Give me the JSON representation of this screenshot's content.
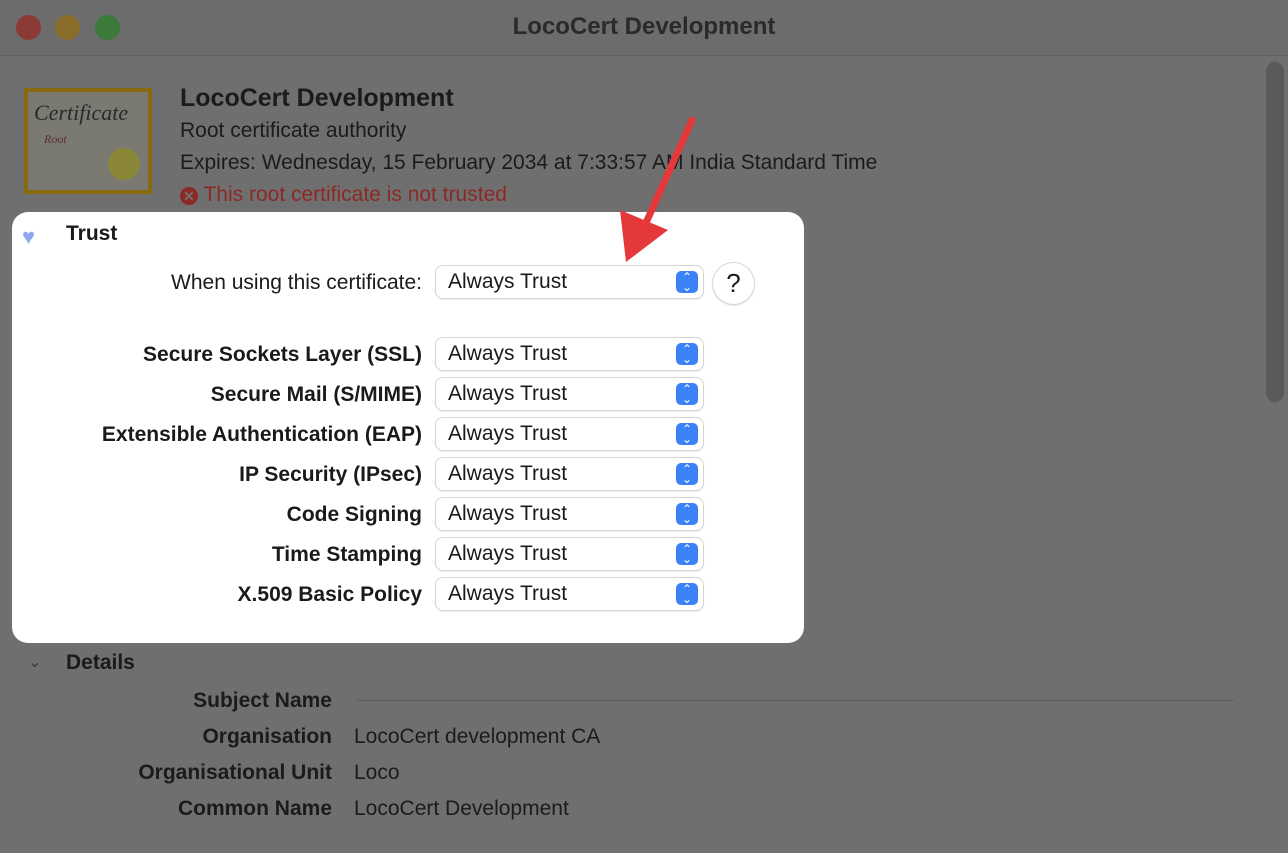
{
  "window": {
    "title": "LocoCert Development"
  },
  "header": {
    "name": "LocoCert Development",
    "kind": "Root certificate authority",
    "expires": "Expires: Wednesday, 15 February 2034 at 7:33:57 AM India Standard Time",
    "status": "This root certificate is not trusted",
    "status_color": "#c0392b",
    "cert_image_text": "Certificate",
    "cert_image_sub": "Root"
  },
  "trust": {
    "title": "Trust",
    "when_label": "When using this certificate:",
    "when_value": "Always Trust",
    "help": "?",
    "policies": [
      {
        "label": "Secure Sockets Layer (SSL)",
        "value": "Always Trust"
      },
      {
        "label": "Secure Mail (S/MIME)",
        "value": "Always Trust"
      },
      {
        "label": "Extensible Authentication (EAP)",
        "value": "Always Trust"
      },
      {
        "label": "IP Security (IPsec)",
        "value": "Always Trust"
      },
      {
        "label": "Code Signing",
        "value": "Always Trust"
      },
      {
        "label": "Time Stamping",
        "value": "Always Trust"
      },
      {
        "label": "X.509 Basic Policy",
        "value": "Always Trust"
      }
    ]
  },
  "details": {
    "title": "Details",
    "subject_heading": "Subject Name",
    "rows": [
      {
        "label": "Organisation",
        "value": "LocoCert development CA"
      },
      {
        "label": "Organisational Unit",
        "value": "Loco"
      },
      {
        "label": "Common Name",
        "value": "LocoCert Development"
      }
    ]
  },
  "colors": {
    "accent": "#3b82f6",
    "arrow": "#e5383b"
  }
}
